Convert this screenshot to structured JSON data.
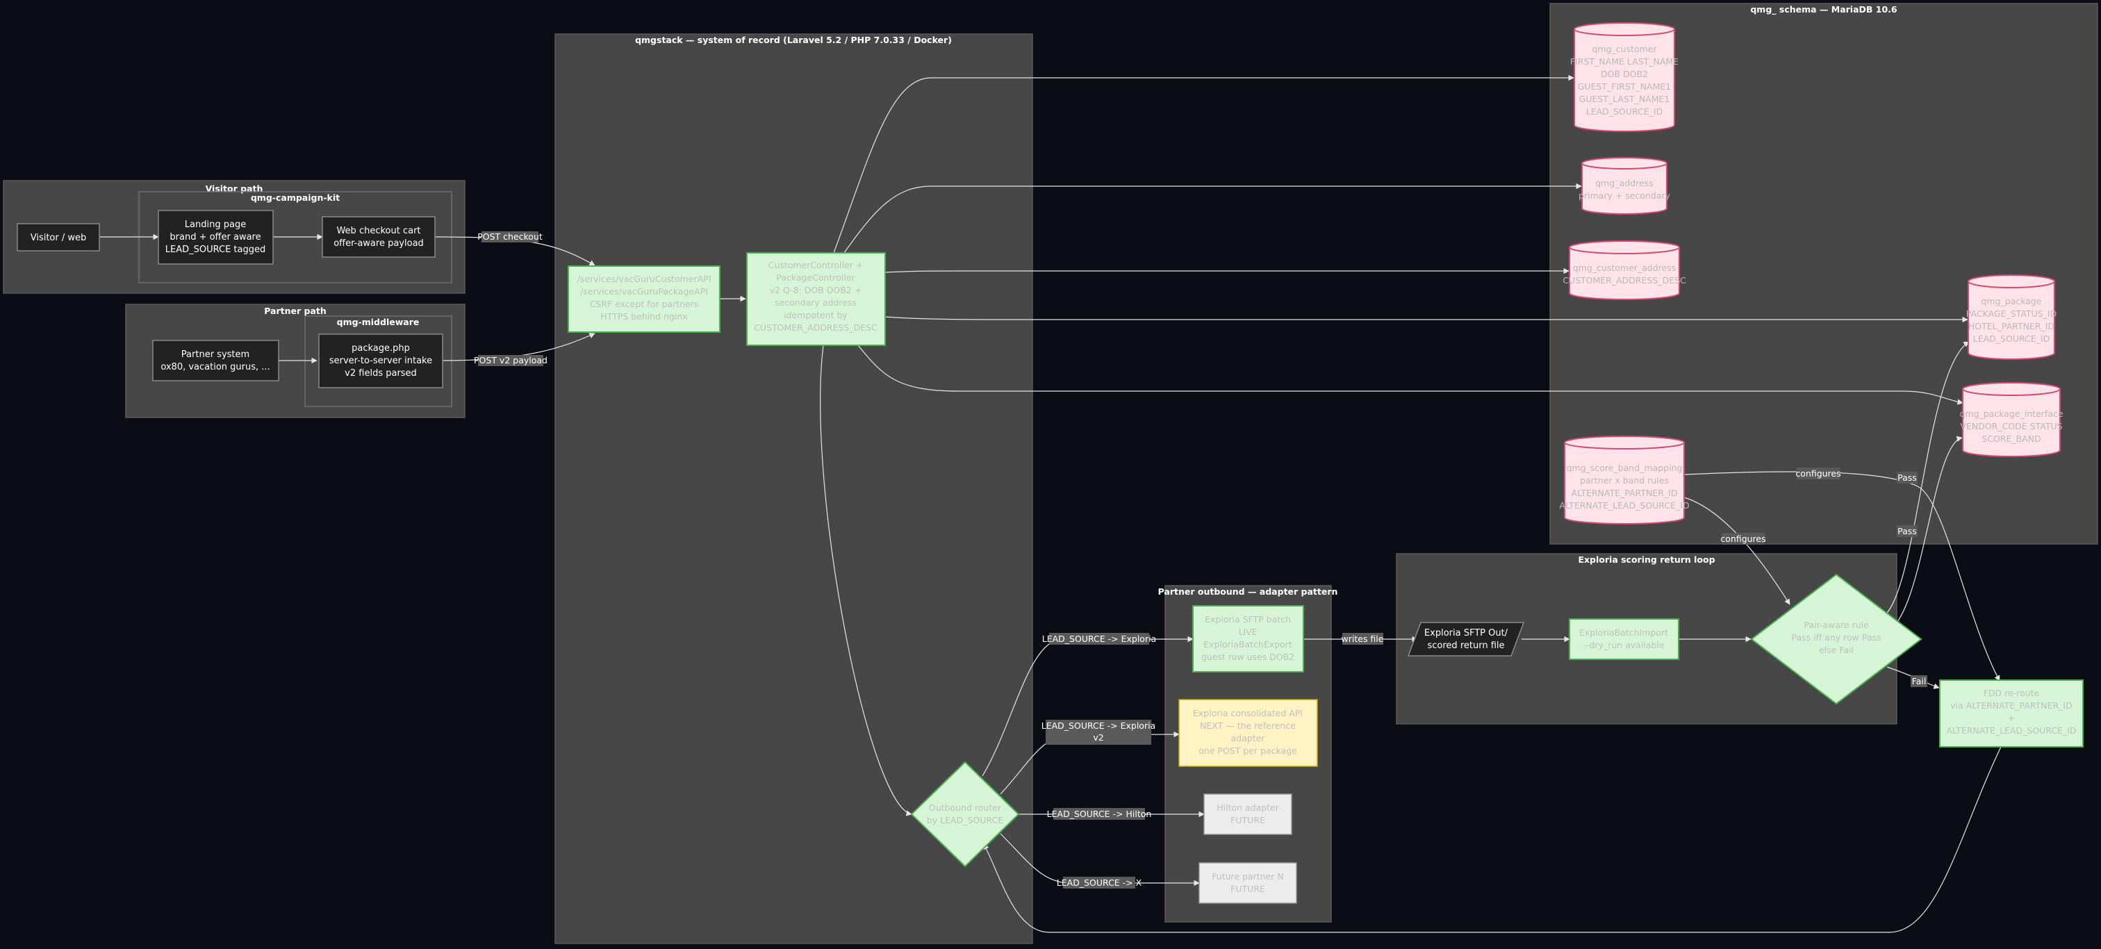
{
  "clusters": {
    "visitor": "Visitor path",
    "campaign_kit": "qmg-campaign-kit",
    "partner": "Partner path",
    "middleware": "qmg-middleware",
    "qmgstack": "qmgstack — system of record (Laravel 5.2 / PHP 7.0.33 / Docker)",
    "schema": "qmg_ schema — MariaDB 10.6",
    "outbound": "Partner outbound — adapter pattern",
    "scoring": "Exploria scoring return loop"
  },
  "nodes": {
    "visitor_web": [
      "Visitor / web"
    ],
    "landing": [
      "Landing page",
      "brand + offer aware",
      "LEAD_SOURCE tagged"
    ],
    "checkout": [
      "Web checkout cart",
      "offer-aware payload"
    ],
    "partner_system": [
      "Partner system",
      "ox80, vacation gurus, ..."
    ],
    "package_php": [
      "package.php",
      "server-to-server intake",
      "v2 fields parsed"
    ],
    "services": [
      "/services/vacGuruCustomerAPI",
      "/services/vacGuruPackageAPI",
      "CSRF except for partners",
      "HTTPS behind nginx"
    ],
    "controller": [
      "CustomerController +",
      "PackageController",
      "v2 Q-8: DOB DOB2 +",
      "secondary address",
      "idempotent by",
      "CUSTOMER_ADDRESS_DESC"
    ],
    "router": [
      "Outbound router",
      "by LEAD_SOURCE"
    ],
    "exploria_sftp": [
      "Exploria SFTP batch",
      "LIVE",
      "ExploriaBatchExport",
      "guest row uses DOB2"
    ],
    "exploria_api": [
      "Exploria consolidated API",
      "NEXT — the reference",
      "adapter",
      "one POST per package"
    ],
    "hilton": [
      "Hilton adapter",
      "FUTURE"
    ],
    "future_partner": [
      "Future partner N",
      "FUTURE"
    ],
    "sftp_out": [
      "Exploria SFTP Out/",
      "scored return file"
    ],
    "batch_import": [
      "ExploriaBatchImport",
      "--dry_run available"
    ],
    "pair_rule": [
      "Pair-aware rule",
      "Pass iff any row Pass",
      "else Fail"
    ],
    "reroute": [
      "FDD re-route",
      "via ALTERNATE_PARTNER_ID",
      "+",
      "ALTERNATE_LEAD_SOURCE_ID"
    ]
  },
  "tables": {
    "customer": [
      "qmg_customer",
      "FIRST_NAME LAST_NAME",
      "DOB DOB2",
      "GUEST_FIRST_NAME1",
      "GUEST_LAST_NAME1",
      "LEAD_SOURCE_ID"
    ],
    "address": [
      "qmg_address",
      "primary + secondary"
    ],
    "customer_address": [
      "qmg_customer_address",
      "CUSTOMER_ADDRESS_DESC"
    ],
    "package": [
      "qmg_package",
      "PACKAGE_STATUS_ID",
      "HOTEL_PARTNER_ID",
      "LEAD_SOURCE_ID"
    ],
    "package_interface": [
      "qmg_package_interface",
      "VENDOR_CODE STATUS",
      "SCORE_BAND"
    ],
    "score_band": [
      "qmg_score_band_mapping",
      "partner x band rules",
      "ALTERNATE_PARTNER_ID",
      "ALTERNATE_LEAD_SOURCE_ID"
    ]
  },
  "edge_labels": {
    "post_checkout": "POST checkout",
    "post_v2": "POST v2 payload",
    "ls_exploria": "LEAD_SOURCE -> Exploria",
    "ls_exploria_v2": [
      "LEAD_SOURCE -> Exploria",
      "v2"
    ],
    "ls_hilton": "LEAD_SOURCE -> Hilton",
    "ls_x": "LEAD_SOURCE -> X",
    "writes_file": "writes file",
    "configures1": "configures",
    "configures2": "configures",
    "pass1": "Pass",
    "pass2": "Pass",
    "fail": "Fail"
  },
  "colors": {
    "background": "#0b0d14",
    "cluster": "#474747",
    "process_green": "#d6f5d6",
    "next_yellow": "#fff3c4",
    "future_grey": "#ececec",
    "db_pink": "#ffe3ea"
  }
}
